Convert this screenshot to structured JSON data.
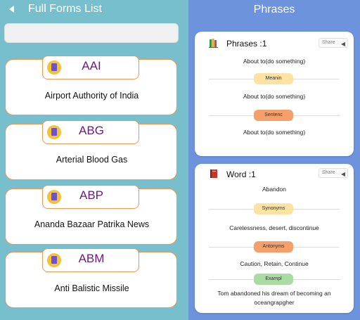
{
  "left": {
    "title": "Full Forms List",
    "search_placeholder": "",
    "items": [
      {
        "abbr": "AAI",
        "full": "Airport Authority of India"
      },
      {
        "abbr": "ABG",
        "full": "Arterial Blood Gas"
      },
      {
        "abbr": "ABP",
        "full": "Ananda Bazaar Patrika News"
      },
      {
        "abbr": "ABM",
        "full": "Anti Balistic Missile"
      }
    ]
  },
  "right": {
    "title": "Phrases",
    "phrases_card": {
      "title": "Phrases :1",
      "share": "Share",
      "line1": "About to(do something)",
      "tag1": "Meanin",
      "line2": "About to(do something)",
      "tag2": "Sentenc",
      "line3": "About to(do something)"
    },
    "word_card": {
      "title": "Word :1",
      "share": "Share",
      "word": "Abandon",
      "tag_synonyms": "Synonyms",
      "synonyms": "Carelessness, desert, discontinue",
      "tag_antonyms": "Antonyms",
      "antonyms": "Caution, Retain, Continue",
      "tag_example": "Exampl",
      "example_line1": "Tom abandoned his dream of becoming an",
      "example_line2": "oceangrapgher"
    }
  },
  "colors": {
    "left_bg": "#77bfcc",
    "right_bg": "#6d93dd",
    "card_border": "#e69a55",
    "abbr_text": "#6a1b7a",
    "tag_meaning": "#fce2a3",
    "tag_sentence": "#f5a06b",
    "tag_example": "#a9dba2"
  }
}
